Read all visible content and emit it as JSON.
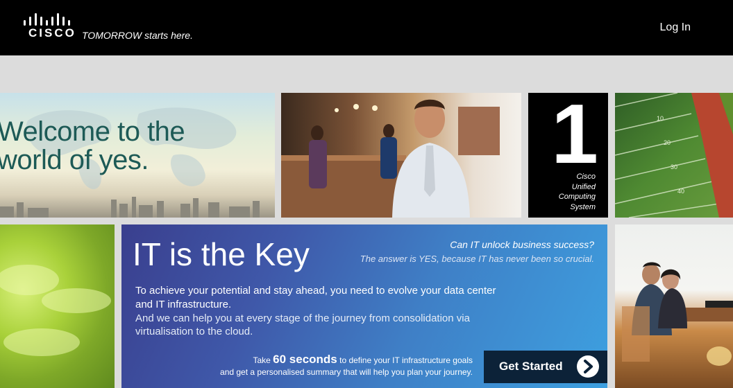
{
  "header": {
    "logo_text": "CISCO",
    "tagline": "TOMORROW starts here.",
    "login_label": "Log In"
  },
  "tiles": {
    "welcome": {
      "line1": "Welcome to the",
      "line2": "world of yes."
    },
    "ucs": {
      "number": "1",
      "lines": [
        "Cisco",
        "Unified",
        "Computing",
        "System"
      ]
    }
  },
  "feature": {
    "title": "IT is the Key",
    "question": "Can IT unlock business success?",
    "answer": "The answer is YES, because IT has never been so crucial.",
    "paragraph1": "To achieve your potential and stay ahead, you need to evolve your data center and IT infrastructure.",
    "paragraph2": "And we can help you at every stage of the journey from consolidation via virtualisation to the cloud.",
    "take_prefix": "Take",
    "take_highlight": "60 seconds",
    "take_suffix": "to define your IT infrastructure goals",
    "take_line2": "and get a personalised summary that will help you plan your journey.",
    "cta_label": "Get Started"
  },
  "colors": {
    "header_bg": "#000000",
    "welcome_text": "#1d5a56",
    "cta_bg": "#0c2238",
    "feature_gradient_start": "#3a3f8e",
    "feature_gradient_end": "#3da0e0"
  }
}
